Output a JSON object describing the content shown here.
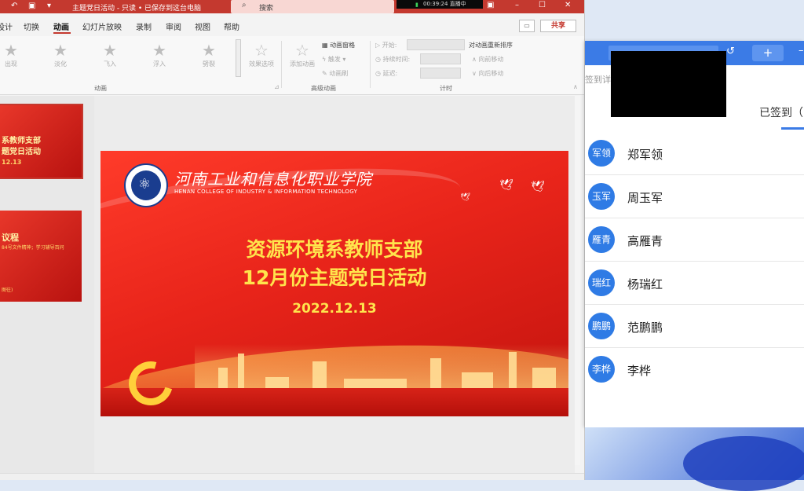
{
  "titlebar": {
    "doc_title": "主题党日活动 - 只读 • 已保存到这台电脑",
    "search_placeholder": "搜索",
    "rec_time": "00:39:24",
    "rec_status": "直播中"
  },
  "tabs": [
    "设计",
    "切换",
    "动画",
    "幻灯片放映",
    "录制",
    "审阅",
    "视图",
    "帮助"
  ],
  "active_tab": "动画",
  "share_label": "共享",
  "ribbon": {
    "effects": [
      "出现",
      "淡化",
      "飞入",
      "浮入",
      "劈裂"
    ],
    "effect_options": "效果选项",
    "add_animation": "添加动画",
    "animation_pane": "动画窗格",
    "trigger": "触发",
    "anim_brush": "动画刷",
    "start_label": "开始:",
    "duration_label": "持续时间:",
    "delay_label": "延迟:",
    "reorder": "对动画重新排序",
    "move_earlier": "向前移动",
    "move_later": "向后移动",
    "group_animation": "动画",
    "group_advanced": "高级动画",
    "group_timing": "计时"
  },
  "thumbs": [
    {
      "line1": "系教师支部",
      "line2": "题党日活动",
      "line3": "12.13"
    },
    {
      "line1": "议程",
      "line2": "84号文件精神；学习辅导百问",
      "line3": "图往)"
    }
  ],
  "slide": {
    "school_cn": "河南工业和信息化职业学院",
    "school_en": "HENAN COLLEGE OF INDUSTRY & INFORMATION TECHNOLOGY",
    "title_line1": "资源环境系教师支部",
    "title_line2": "12月份主题党日活动",
    "date": "2022.12.13"
  },
  "panel": {
    "detail_label": "签到详",
    "signed_label": "已签到（",
    "members": [
      {
        "avatar": "军领",
        "name": "郑军领"
      },
      {
        "avatar": "玉军",
        "name": "周玉军"
      },
      {
        "avatar": "雁青",
        "name": "高雁青"
      },
      {
        "avatar": "瑞红",
        "name": "杨瑞红"
      },
      {
        "avatar": "鹏鹏",
        "name": "范鹏鹏"
      },
      {
        "avatar": "李桦",
        "name": "李桦"
      }
    ]
  },
  "colors": {
    "ppt_accent": "#c4392f",
    "panel_accent": "#3b7be6",
    "slide_title": "#ffe44c"
  }
}
